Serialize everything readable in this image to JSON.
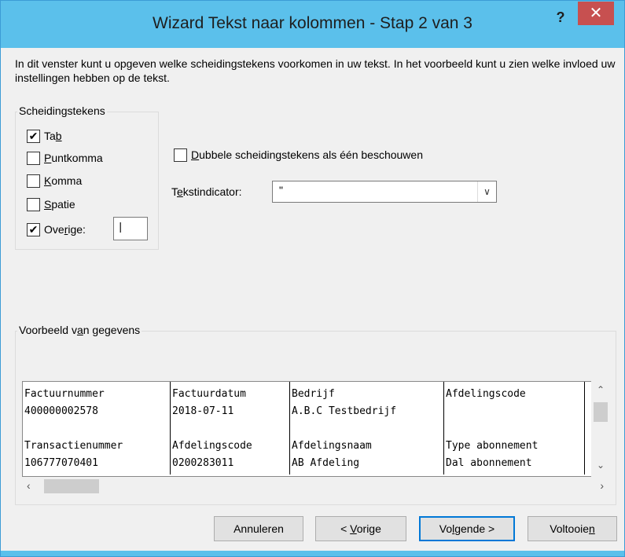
{
  "window": {
    "title": "Wizard Tekst naar kolommen - Stap 2 van 3",
    "help_label": "?",
    "close_label": "✕"
  },
  "intro_text": "In dit venster kunt u opgeven welke scheidingstekens voorkomen in uw tekst. In het voorbeeld kunt u zien welke invloed uw instellingen hebben op de tekst.",
  "delimiters": {
    "legend": "Scheidingstekens",
    "tab": {
      "pre": "Ta",
      "ul": "b",
      "post": "",
      "checked": true
    },
    "semicolon": {
      "pre": "",
      "ul": "P",
      "post": "untkomma",
      "checked": false
    },
    "comma": {
      "pre": "",
      "ul": "K",
      "post": "omma",
      "checked": false
    },
    "space": {
      "pre": "",
      "ul": "S",
      "post": "patie",
      "checked": false
    },
    "other": {
      "pre": "Ove",
      "ul": "r",
      "post": "ige:",
      "checked": true,
      "value": "|"
    }
  },
  "consecutive": {
    "pre": "",
    "ul": "D",
    "post": "ubbele scheidingstekens als één beschouwen",
    "checked": false
  },
  "text_qualifier": {
    "pre": "T",
    "ul": "e",
    "post": "kstindicator:",
    "value": "\""
  },
  "preview": {
    "legend_pre": "Voorbeeld v",
    "legend_ul": "a",
    "legend_post": "n gegevens",
    "rows": [
      [
        "Factuurnummer",
        "Factuurdatum",
        "Bedrijf",
        "Afdelingscode"
      ],
      [
        "400000002578",
        "2018-07-11",
        "A.B.C Testbedrijf",
        ""
      ],
      [
        "",
        "",
        "",
        ""
      ],
      [
        "Transactienummer",
        "Afdelingscode",
        "Afdelingsnaam",
        "Type abonnement"
      ],
      [
        "106777070401",
        "0200283011",
        "AB Afdeling",
        "Dal abonnement"
      ]
    ]
  },
  "buttons": {
    "cancel": {
      "pre": "Annuleren",
      "ul": "",
      "post": ""
    },
    "back": {
      "pre": "< ",
      "ul": "V",
      "post": "orige"
    },
    "next": {
      "pre": "Vo",
      "ul": "l",
      "post": "gende >"
    },
    "finish": {
      "pre": "Voltooie",
      "ul": "n",
      "post": ""
    }
  }
}
